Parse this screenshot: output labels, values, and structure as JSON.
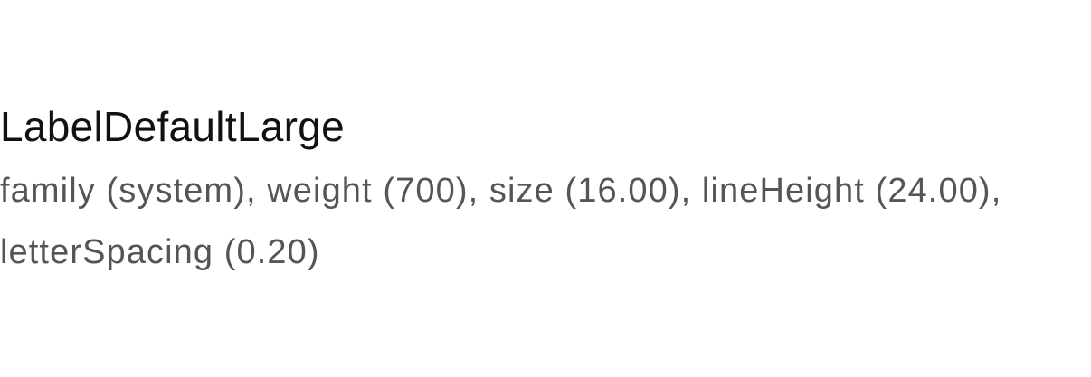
{
  "token": {
    "name": "LabelDefaultLarge",
    "spec": "family (system), weight (700), size (16.00), lineHeight (24.00), letterSpacing (0.20)"
  }
}
